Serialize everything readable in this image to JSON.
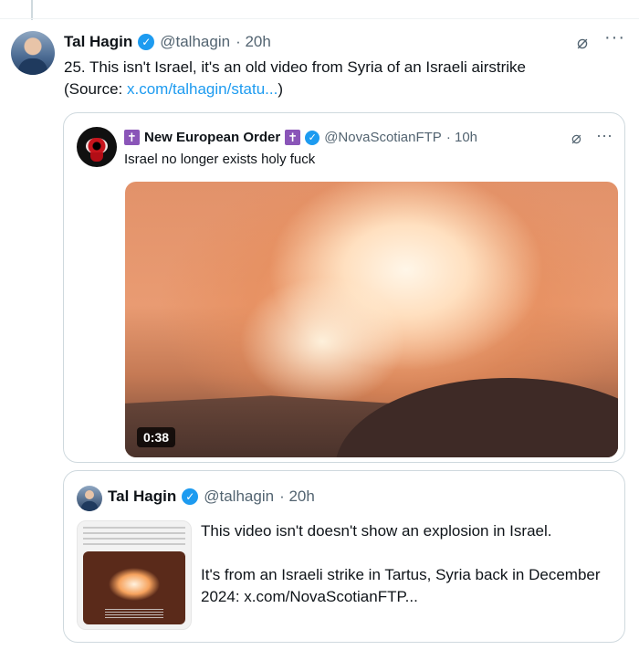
{
  "tweet": {
    "author_name": "Tal Hagin",
    "handle": "@talhagin",
    "time": "· 20h",
    "text": "25.  This isn't Israel, it's an old video from Syria of an Israeli airstrike",
    "source_prefix": "(Source: ",
    "source_link": "x.com/talhagin/statu...",
    "source_suffix": ")"
  },
  "quote1": {
    "author_name": "New European Order",
    "handle": "@NovaScotianFTP",
    "time": "· 10h",
    "text": "Israel no longer exists holy fuck",
    "video_duration": "0:38"
  },
  "quote2": {
    "author_name": "Tal Hagin",
    "handle": "@talhagin",
    "time": "· 20h",
    "line1": "This video isn't doesn't show an explosion in Israel.",
    "line2": "It's from an Israeli strike in Tartus, Syria back in December 2024:  x.com/NovaScotianFTP..."
  },
  "icons": {
    "verified": "✓",
    "cross": "✝",
    "grok": "⌀",
    "more": "···"
  },
  "colors": {
    "link": "#1d9bf0",
    "verified": "#1d9bf0",
    "muted": "#536471",
    "border": "#cfd9de"
  }
}
